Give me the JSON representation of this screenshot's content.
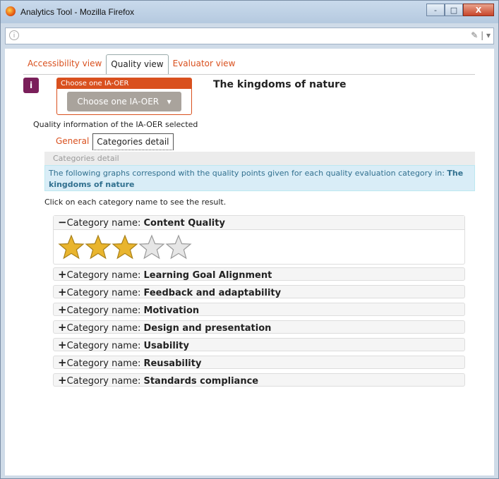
{
  "window": {
    "title": "Analytics Tool - Mozilla Firefox",
    "buttons": [
      "-",
      "□",
      "X"
    ]
  },
  "urlbar": {
    "value": ""
  },
  "views": [
    {
      "label": "Accessibility view",
      "active": false
    },
    {
      "label": "Quality view",
      "active": true
    },
    {
      "label": "Evaluator view",
      "active": false
    }
  ],
  "choose": {
    "header": "Choose one IA-OER",
    "button": "Choose one IA-OER"
  },
  "doc_title": "The kingdoms of nature",
  "quality_info_label": "Quality information of the IA-OER selected",
  "sub_tabs": [
    {
      "label": "General",
      "active": false
    },
    {
      "label": "Categories detail",
      "active": true
    }
  ],
  "categories_detail_bar": "Categories detail",
  "notice": {
    "text": "The following graphs correspond with the quality points given for each quality evaluation category in: ",
    "bold": "The kingdoms of nature"
  },
  "click_hint": "Click on each category name to see the result.",
  "category_prefix": "Category name: ",
  "categories": [
    {
      "name": "Content Quality",
      "expanded": true,
      "sign": "−",
      "stars": 3,
      "max_stars": 5
    },
    {
      "name": "Learning Goal Alignment",
      "expanded": false,
      "sign": "+"
    },
    {
      "name": "Feedback and adaptability",
      "expanded": false,
      "sign": "+"
    },
    {
      "name": "Motivation",
      "expanded": false,
      "sign": "+"
    },
    {
      "name": "Design and presentation",
      "expanded": false,
      "sign": "+"
    },
    {
      "name": "Usability",
      "expanded": false,
      "sign": "+"
    },
    {
      "name": "Reusability",
      "expanded": false,
      "sign": "+"
    },
    {
      "name": "Standards compliance",
      "expanded": false,
      "sign": "+"
    }
  ],
  "colors": {
    "accent": "#d9501e",
    "star_filled": "#e9b52e",
    "star_empty": "#e6e6e6"
  }
}
